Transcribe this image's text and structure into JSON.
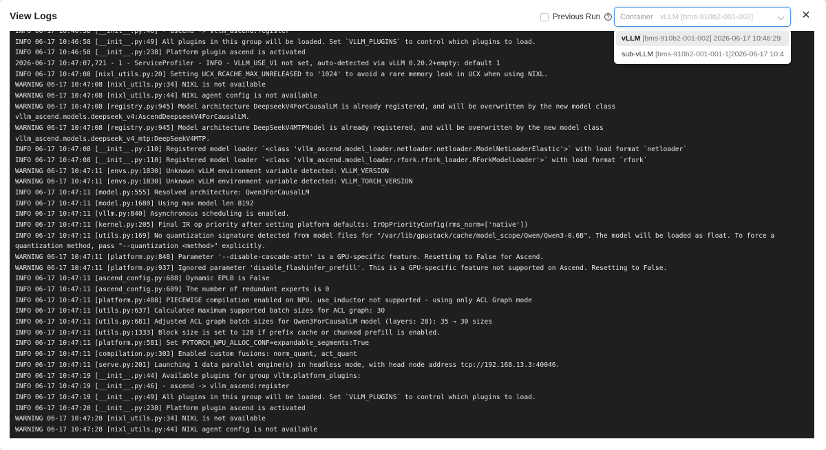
{
  "dialog": {
    "title": "View Logs"
  },
  "previous_run": {
    "label": "Previous Run",
    "checked": false
  },
  "container_select": {
    "prefix": "Container",
    "selected_name": "vLLM",
    "selected_pod": "[bms-910b2-001-002]"
  },
  "dropdown": {
    "options": [
      {
        "name": "vLLM",
        "pod": "[bms-910b2-001-002]",
        "time": "2026-06-17 10:46:29"
      },
      {
        "name": "sub-vLLM",
        "pod": "[bms-910b2-001-001-1]",
        "time": "2026-06-17 10:4"
      }
    ]
  },
  "icons": {
    "help": "question-circle-icon",
    "close": "close-icon",
    "chevron": "chevron-down-icon"
  },
  "colors": {
    "accent": "#4a90e2",
    "log_bg": "#1f1f1f",
    "log_text": "#e6e6e6"
  },
  "log_lines": [
    "INFO 06-17 10:46:58 [__init__.py:46] - ascend -> vllm_ascend:register",
    "INFO 06-17 10:46:58 [__init__.py:49] All plugins in this group will be loaded. Set `VLLM_PLUGINS` to control which plugins to load.",
    "INFO 06-17 10:46:58 [__init__.py:238] Platform plugin ascend is activated",
    "2026-06-17 10:47:07,721 - 1 - ServiceProfiler - INFO - VLLM_USE_V1 not set, auto-detected via vLLM 0.20.2+empty: default 1",
    "INFO 06-17 10:47:08 [nixl_utils.py:20] Setting UCX_RCACHE_MAX_UNRELEASED to '1024' to avoid a rare memory leak in UCX when using NIXL.",
    "WARNING 06-17 10:47:08 [nixl_utils.py:34] NIXL is not available",
    "WARNING 06-17 10:47:08 [nixl_utils.py:44] NIXL agent config is not available",
    "WARNING 06-17 10:47:08 [registry.py:945] Model architecture DeepseekV4ForCausalLM is already registered, and will be overwritten by the new model class",
    "vllm_ascend.models.deepseek_v4:AscendDeepseekV4ForCausalLM.",
    "WARNING 06-17 10:47:08 [registry.py:945] Model architecture DeepSeekV4MTPModel is already registered, and will be overwritten by the new model class",
    "vllm_ascend.models.deepseek_v4_mtp:DeepSeekV4MTP.",
    "INFO 06-17 10:47:08 [__init__.py:110] Registered model loader `<class 'vllm_ascend.model_loader.netloader.netloader.ModelNetLoaderElastic'>` with load format `netloader`",
    "INFO 06-17 10:47:08 [__init__.py:110] Registered model loader `<class 'vllm_ascend.model_loader.rfork.rfork_loader.RForkModelLoader'>` with load format `rfork`",
    "WARNING 06-17 10:47:11 [envs.py:1830] Unknown vLLM environment variable detected: VLLM_VERSION",
    "WARNING 06-17 10:47:11 [envs.py:1830] Unknown vLLM environment variable detected: VLLM_TORCH_VERSION",
    "INFO 06-17 10:47:11 [model.py:555] Resolved architecture: Qwen3ForCausalLM",
    "INFO 06-17 10:47:11 [model.py:1680] Using max model len 8192",
    "INFO 06-17 10:47:11 [vllm.py:840] Asynchronous scheduling is enabled.",
    "INFO 06-17 10:47:11 [kernel.py:205] Final IR op priority after setting platform defaults: IrOpPriorityConfig(rms_norm=['native'])",
    "INFO 06-17 10:47:11 [utils.py:169] No quantization signature detected from model files for \"/var/lib/gpustack/cache/model_scope/Qwen/Qwen3-0.6B\". The model will be loaded as float. To force a",
    "quantization method, pass \"--quantization <method>\" explicitly.",
    "WARNING 06-17 10:47:11 [platform.py:848] Parameter '--disable-cascade-attn' is a GPU-specific feature. Resetting to False for Ascend.",
    "WARNING 06-17 10:47:11 [platform.py:937] Ignored parameter 'disable_flashinfer_prefill'. This is a GPU-specific feature not supported on Ascend. Resetting to False.",
    "INFO 06-17 10:47:11 [ascend_config.py:688] Dynamic EPLB is False",
    "INFO 06-17 10:47:11 [ascend_config.py:689] The number of redundant experts is 0",
    "INFO 06-17 10:47:11 [platform.py:408] PIECEWISE compilation enabled on NPU. use_inductor not supported - using only ACL Graph mode",
    "INFO 06-17 10:47:11 [utils.py:637] Calculated maximum supported batch sizes for ACL graph: 30",
    "INFO 06-17 10:47:11 [utils.py:681] Adjusted ACL graph batch sizes for Qwen3ForCausalLM model (layers: 28): 35 → 30 sizes",
    "INFO 06-17 10:47:11 [utils.py:1333] Block size is set to 128 if prefix cache or chunked prefill is enabled.",
    "INFO 06-17 10:47:11 [platform.py:581] Set PYTORCH_NPU_ALLOC_CONF=expandable_segments:True",
    "INFO 06-17 10:47:11 [compilation.py:303] Enabled custom fusions: norm_quant, act_quant",
    "INFO 06-17 10:47:11 [serve.py:201] Launching 1 data parallel engine(s) in headless mode, with head node address tcp://192.168.13.3:40046.",
    "INFO 06-17 10:47:19 [__init__.py:44] Available plugins for group vllm.platform_plugins:",
    "INFO 06-17 10:47:19 [__init__.py:46] - ascend -> vllm_ascend:register",
    "INFO 06-17 10:47:19 [__init__.py:49] All plugins in this group will be loaded. Set `VLLM_PLUGINS` to control which plugins to load.",
    "INFO 06-17 10:47:20 [__init__.py:238] Platform plugin ascend is activated",
    "WARNING 06-17 10:47:28 [nixl_utils.py:34] NIXL is not available",
    "WARNING 06-17 10:47:28 [nixl_utils.py:44] NIXL agent config is not available"
  ]
}
